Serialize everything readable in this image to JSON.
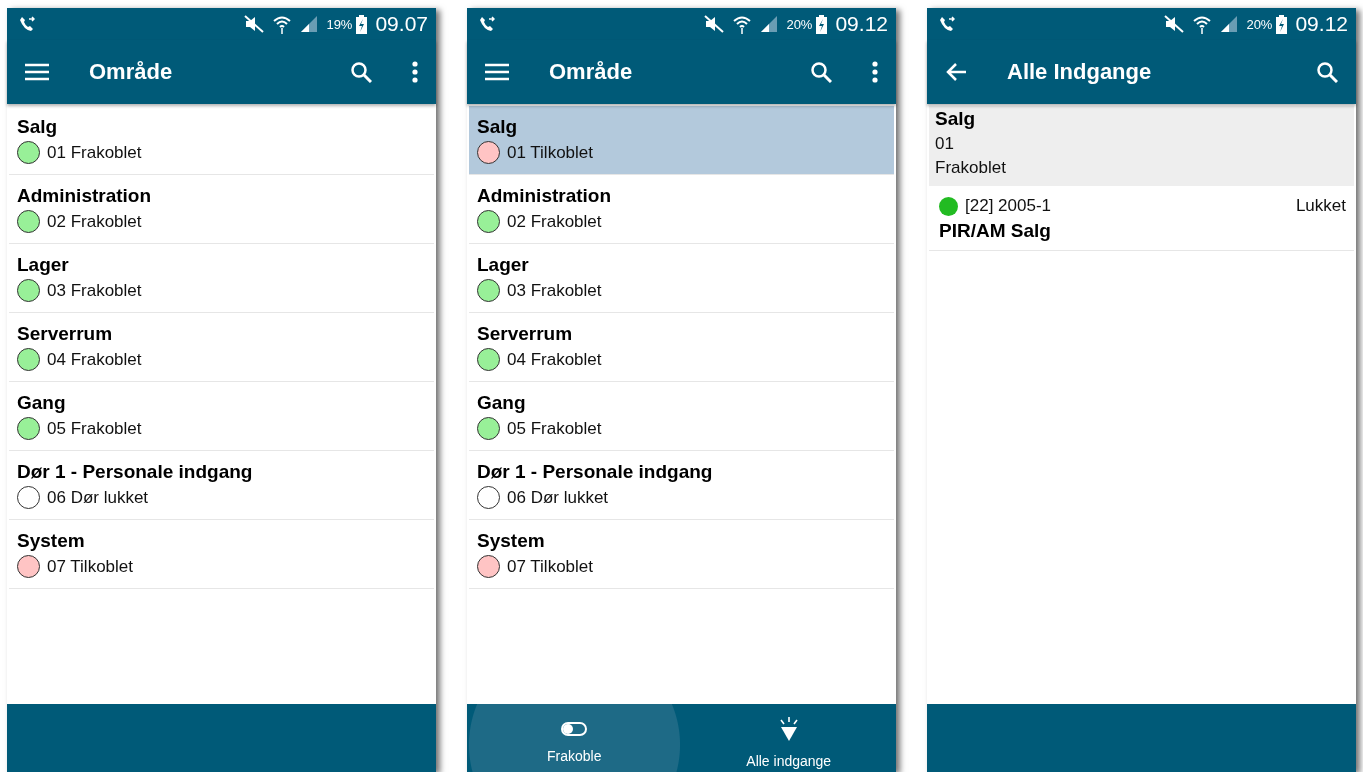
{
  "screens": [
    {
      "status_bar": {
        "battery": "19%",
        "time": "09.07"
      },
      "app_bar": {
        "nav": {
          "kind": "menu"
        },
        "title": "Område",
        "actions": [
          {
            "kind": "search"
          },
          {
            "kind": "more"
          }
        ]
      },
      "areas": [
        {
          "name": "Salg",
          "status": "01 Frakoblet",
          "color": "#98f098",
          "selected": false
        },
        {
          "name": "Administration",
          "status": "02 Frakoblet",
          "color": "#98f098",
          "selected": false
        },
        {
          "name": "Lager",
          "status": "03 Frakoblet",
          "color": "#98f098",
          "selected": false
        },
        {
          "name": "Serverrum",
          "status": "04 Frakoblet",
          "color": "#98f098",
          "selected": false
        },
        {
          "name": "Gang",
          "status": "05 Frakoblet",
          "color": "#98f098",
          "selected": false
        },
        {
          "name": "Dør 1 - Personale indgang",
          "status": "06 Dør lukket",
          "color": "#ffffff",
          "selected": false
        },
        {
          "name": "System",
          "status": "07 Tilkoblet",
          "color": "#ffc4c4",
          "selected": false
        }
      ]
    },
    {
      "status_bar": {
        "battery": "20%",
        "time": "09.12"
      },
      "app_bar": {
        "nav": {
          "kind": "menu"
        },
        "title": "Område",
        "actions": [
          {
            "kind": "search"
          },
          {
            "kind": "more"
          }
        ]
      },
      "areas": [
        {
          "name": "Salg",
          "status": "01 Tilkoblet",
          "color": "#ffc4c4",
          "selected": true
        },
        {
          "name": "Administration",
          "status": "02 Frakoblet",
          "color": "#98f098",
          "selected": false
        },
        {
          "name": "Lager",
          "status": "03 Frakoblet",
          "color": "#98f098",
          "selected": false
        },
        {
          "name": "Serverrum",
          "status": "04 Frakoblet",
          "color": "#98f098",
          "selected": false
        },
        {
          "name": "Gang",
          "status": "05 Frakoblet",
          "color": "#98f098",
          "selected": false
        },
        {
          "name": "Dør 1 - Personale indgang",
          "status": "06 Dør lukket",
          "color": "#ffffff",
          "selected": false
        },
        {
          "name": "System",
          "status": "07 Tilkoblet",
          "color": "#ffc4c4",
          "selected": false
        }
      ],
      "bottom_actions": [
        {
          "kind": "toggle",
          "label": "Frakoble",
          "pressed": true
        },
        {
          "kind": "flashlight",
          "label": "Alle indgange",
          "pressed": false
        }
      ]
    },
    {
      "status_bar": {
        "battery": "20%",
        "time": "09.12"
      },
      "app_bar": {
        "nav": {
          "kind": "back"
        },
        "title": "Alle Indgange",
        "actions": [
          {
            "kind": "search"
          }
        ]
      },
      "header": {
        "name": "Salg",
        "number": "01",
        "status": "Frakoblet"
      },
      "entries": [
        {
          "color": "#22bb22",
          "id": "[22] 2005-1",
          "state": "Lukket",
          "name": "PIR/AM Salg"
        }
      ]
    }
  ]
}
